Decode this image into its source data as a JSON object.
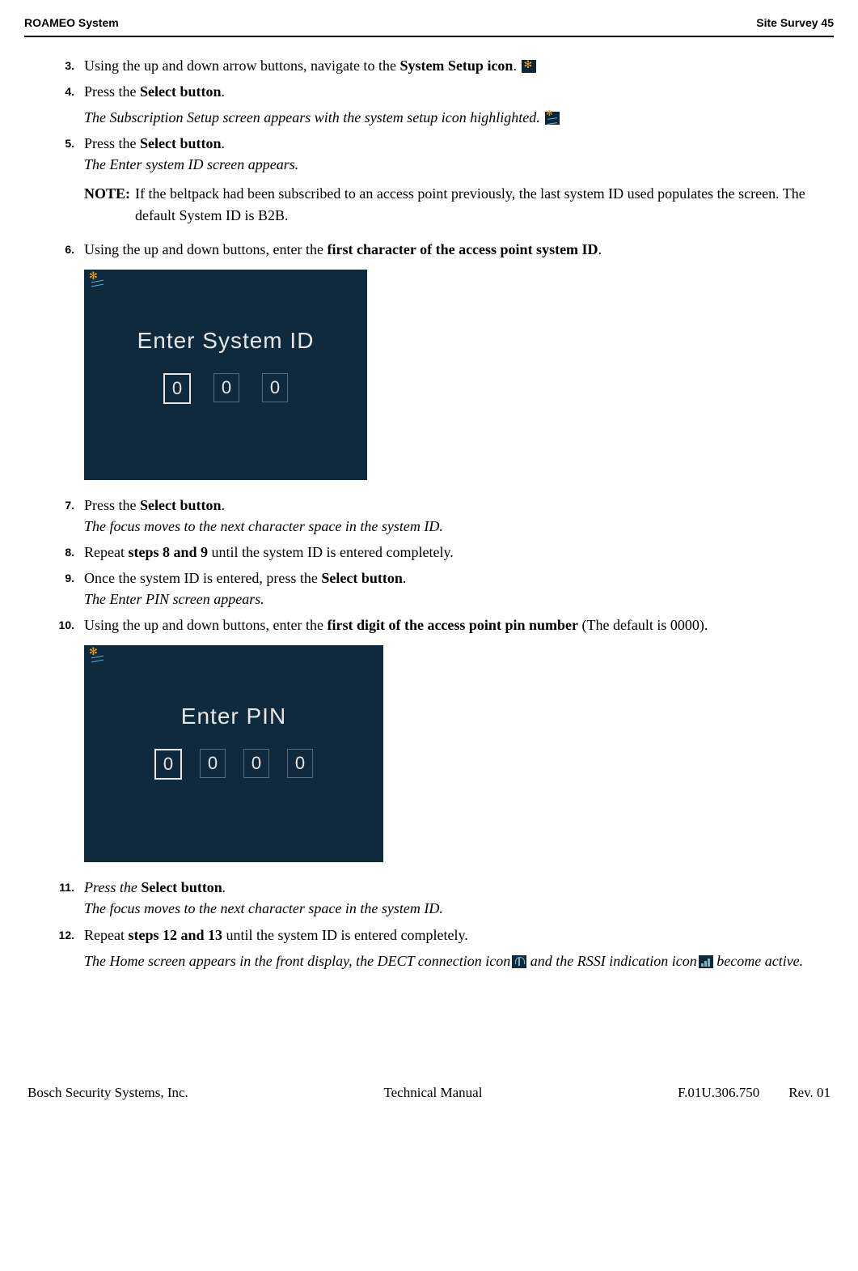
{
  "header": {
    "left": "ROAMEO System",
    "right": "Site Survey  45"
  },
  "steps": {
    "s3": {
      "num": "3.",
      "text_a": "Using the up and down arrow buttons, navigate to the ",
      "text_b": "System Setup icon",
      "text_c": "."
    },
    "s4": {
      "num": "4.",
      "text_a": "Press the ",
      "text_b": "Select button",
      "text_c": ".",
      "sub": "The Subscription Setup screen appears with the system setup icon highlighted."
    },
    "s5": {
      "num": "5.",
      "text_a": "Press the ",
      "text_b": "Select button",
      "text_c": ".",
      "sub": "The Enter system ID screen appears."
    },
    "note": {
      "label": "NOTE:",
      "text": "If the beltpack had been subscribed to an access point previously, the last system ID used populates the screen. The default System ID is B2B."
    },
    "s6": {
      "num": "6.",
      "text_a": "Using the up and down buttons, enter the ",
      "text_b": "first character of the access point system ID",
      "text_c": "."
    },
    "s7": {
      "num": "7.",
      "text_a": "Press the ",
      "text_b": "Select button",
      "text_c": ".",
      "sub": "The focus moves to the next character space in the system ID."
    },
    "s8": {
      "num": "8.",
      "text_a": "Repeat ",
      "text_b": "steps 8 and 9",
      "text_c": " until the system ID is entered completely."
    },
    "s9": {
      "num": "9.",
      "text_a": "Once the system ID is entered, press the ",
      "text_b": "Select button",
      "text_c": ".",
      "sub": "The Enter PIN screen appears."
    },
    "s10": {
      "num": "10.",
      "text_a": "Using the up and down buttons, enter the ",
      "text_b": "first digit of the access point pin number",
      "text_c": " (The default is 0000)."
    },
    "s11": {
      "num": "11.",
      "text_a": "Press the ",
      "text_b": "Select button",
      "text_c": ".",
      "sub": "The focus moves to the next character space in the system ID."
    },
    "s12": {
      "num": "12.",
      "text_a": "Repeat ",
      "text_b": "steps 12 and 13",
      "text_c": " until the system ID is entered completely.",
      "sub_a": "The Home screen appears in the front display, the DECT connection icon",
      "sub_b": " and the RSSI indication icon",
      "sub_c": " become active."
    }
  },
  "screens": {
    "sysid": {
      "title": "Enter System ID",
      "digits": [
        "0",
        "0",
        "0"
      ]
    },
    "pin": {
      "title": "Enter PIN",
      "digits": [
        "0",
        "0",
        "0",
        "0"
      ]
    }
  },
  "footer": {
    "left": "Bosch Security Systems, Inc.",
    "center": "Technical Manual",
    "doc": "F.01U.306.750",
    "rev": "Rev. 01"
  }
}
